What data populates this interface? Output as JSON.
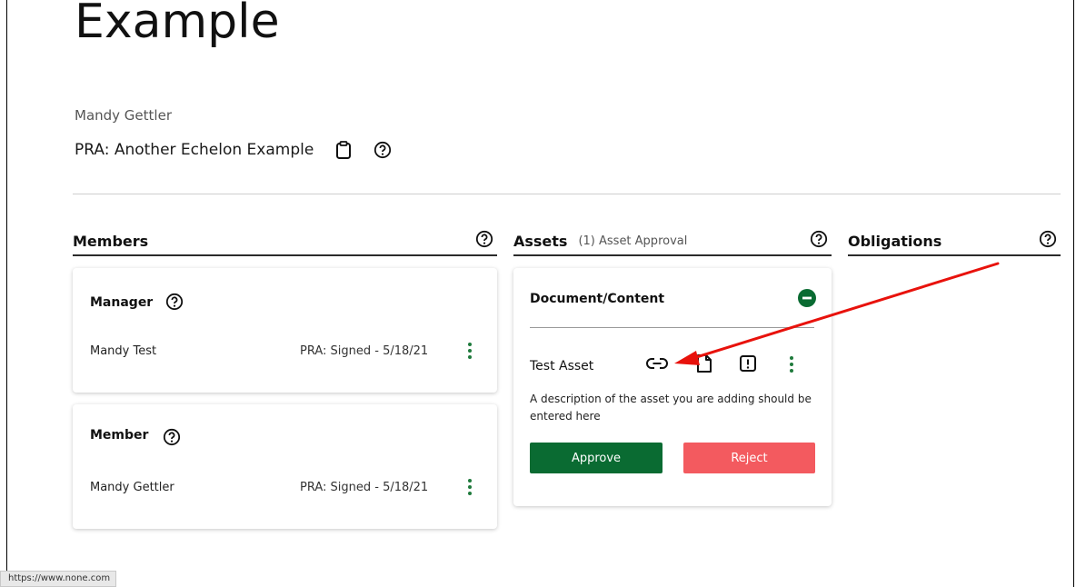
{
  "page": {
    "title": "Example",
    "owner": "Mandy Gettler",
    "pra_title": "PRA: Another Echelon Example"
  },
  "members": {
    "heading": "Members",
    "groups": [
      {
        "role": "Manager",
        "member_name": "Mandy Test",
        "status": "PRA: Signed - 5/18/21"
      },
      {
        "role": "Member",
        "member_name": "Mandy Gettler",
        "status": "PRA: Signed - 5/18/21"
      }
    ]
  },
  "assets": {
    "heading": "Assets",
    "subheading": "(1) Asset Approval",
    "card": {
      "category": "Document/Content",
      "asset_name": "Test Asset",
      "description": "A description of the asset you are adding should be entered here",
      "approve_label": "Approve",
      "reject_label": "Reject"
    }
  },
  "obligations": {
    "heading": "Obligations"
  },
  "status_bar": {
    "url": "https://www.none.com"
  },
  "colors": {
    "accent_green": "#0a6b32",
    "reject_red": "#f35a5f",
    "annotation_arrow": "#e8120c"
  },
  "icons": [
    "clipboard-icon",
    "help-icon",
    "minus-circle-icon",
    "link-icon",
    "file-icon",
    "alert-icon",
    "kebab-menu-icon"
  ]
}
